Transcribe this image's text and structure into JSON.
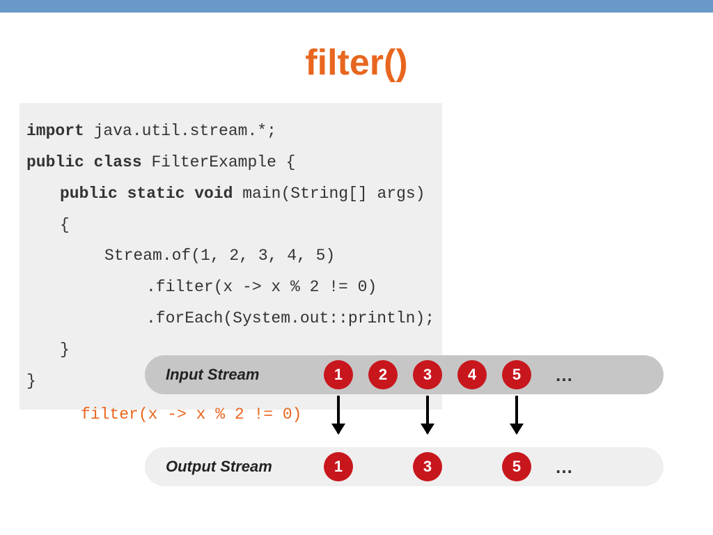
{
  "title": "filter()",
  "code": {
    "line1_kw": "import",
    "line1_rest": " java.util.stream.*;",
    "line2_kw": "public class",
    "line2_rest": " FilterExample {",
    "line3_kw": "public static void",
    "line3_rest": " main(String[] args) {",
    "line4": "Stream.of(1, 2, 3, 4, 5)",
    "line5": ".filter(x -> x % 2 != 0)",
    "line6": ".forEach(System.out::println);",
    "line7": "}",
    "line8": "}"
  },
  "diagram": {
    "input_label": "Input Stream",
    "output_label": "Output Stream",
    "filter_expr": "filter(x -> x % 2 != 0)",
    "input_values": [
      "1",
      "2",
      "3",
      "4",
      "5"
    ],
    "output_values": [
      "1",
      "3",
      "5"
    ],
    "ellipsis": "…"
  }
}
